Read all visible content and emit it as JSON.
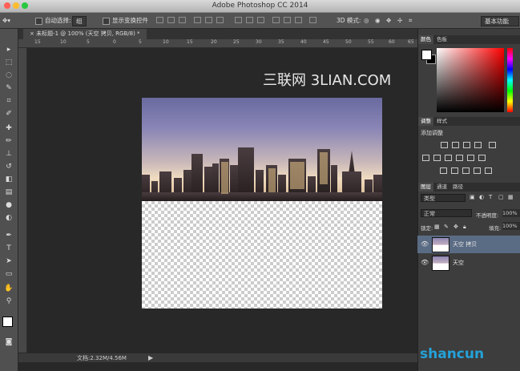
{
  "titlebar": {
    "title": "Adobe Photoshop CC 2014"
  },
  "options_bar": {
    "auto_select_label": "自动选择:",
    "auto_select_value": "组",
    "show_transform_label": "显示变换控件",
    "mode_3d_label": "3D 模式:",
    "workspace": "基本功能"
  },
  "document": {
    "tab_label": "未标题-1 @ 100% (天空 拷贝, RGB/8) *",
    "zoom": "100%",
    "status": "文档:2.32M/4.56M",
    "ruler_marks": [
      "15",
      "10",
      "5",
      "0",
      "5",
      "10",
      "15",
      "20",
      "25",
      "30",
      "35",
      "40",
      "45",
      "50",
      "55",
      "60",
      "65"
    ]
  },
  "watermark": "三联网 3LIAN.COM",
  "panels": {
    "color_tabs": [
      "颜色",
      "色板"
    ],
    "adjust_tabs": [
      "调整",
      "样式"
    ],
    "adjust_title": "添加调整",
    "layers_tabs": [
      "图层",
      "通道",
      "路径"
    ],
    "kind_filter": "类型",
    "blend_mode": "正常",
    "opacity_label": "不透明度:",
    "opacity_value": "100%",
    "lock_label": "锁定:",
    "fill_label": "填充:",
    "fill_value": "100%",
    "layers": [
      {
        "name": "天空 拷贝",
        "selected": true
      },
      {
        "name": "天空",
        "selected": false
      }
    ]
  },
  "site_logo": "shancun",
  "colors": {
    "selected_layer": "#5a6b84",
    "panel_bg": "#3d3d3d",
    "accent": "#24a2d8"
  }
}
